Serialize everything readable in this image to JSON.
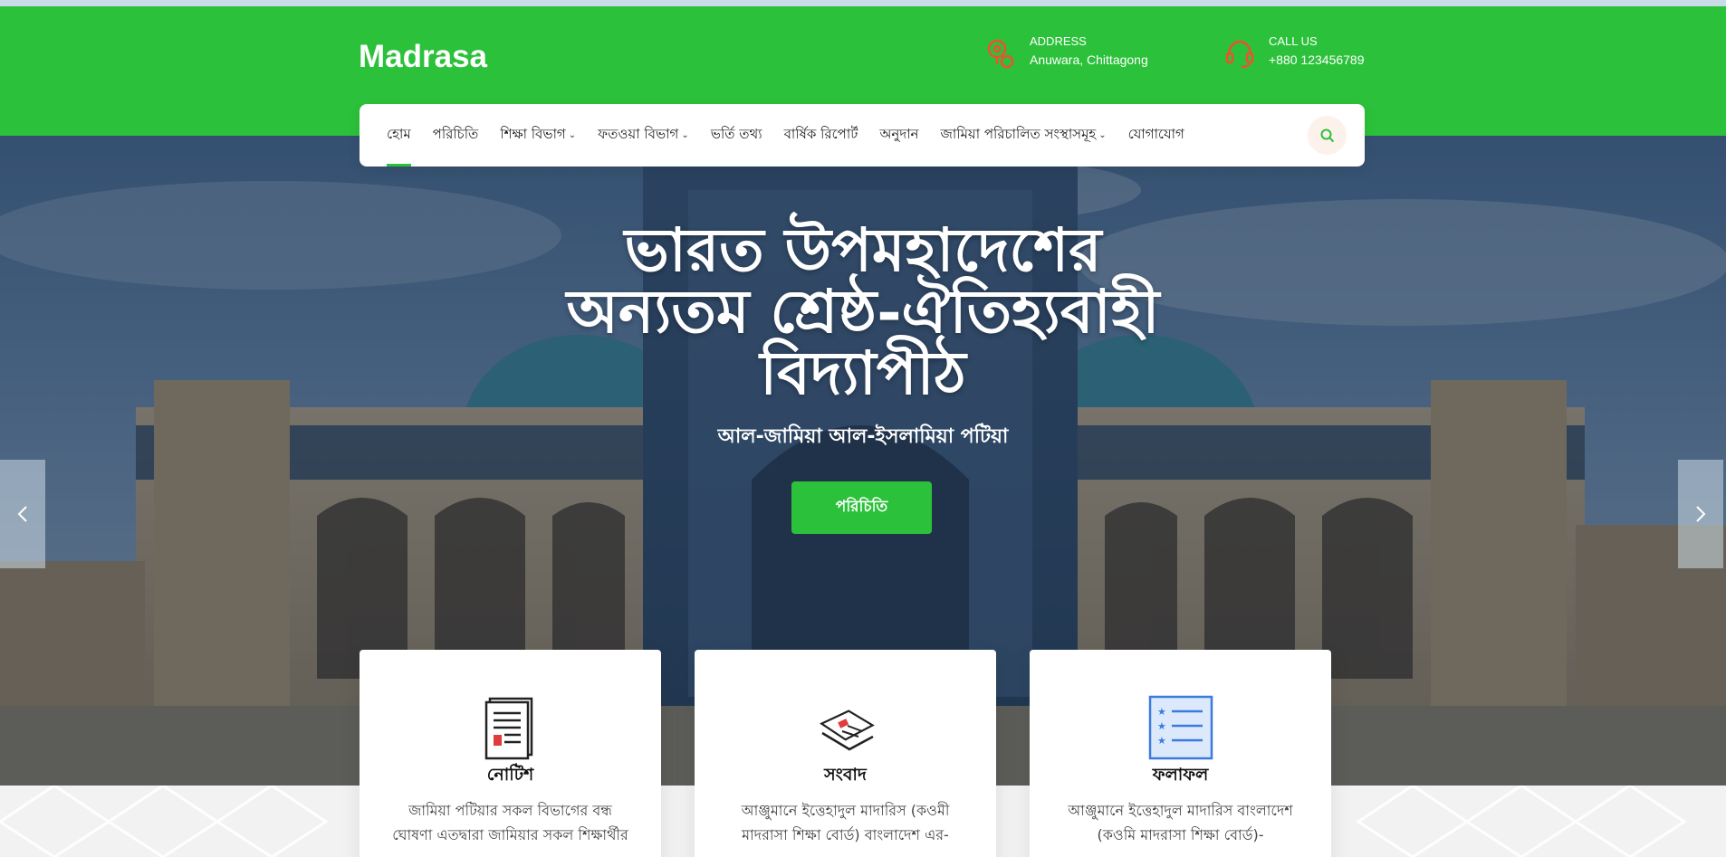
{
  "site": {
    "logo": "Madrasa"
  },
  "header": {
    "address": {
      "label": "ADDRESS",
      "value": "Anuwara, Chittagong",
      "icon": "location-pin-icon"
    },
    "call": {
      "label": "CALL US",
      "value": "+880 123456789",
      "icon": "headset-icon"
    }
  },
  "nav": {
    "items": [
      {
        "label": "হোম",
        "active": true
      },
      {
        "label": "পরিচিতি"
      },
      {
        "label": "শিক্ষা বিভাগ",
        "dropdown": true
      },
      {
        "label": "ফতওয়া বিভাগ",
        "dropdown": true
      },
      {
        "label": "ভর্তি তথ্য"
      },
      {
        "label": "বার্ষিক রিপোর্ট"
      },
      {
        "label": "অনুদান"
      },
      {
        "label": "জামিয়া পরিচালিত সংস্থাসমূহ",
        "dropdown": true
      },
      {
        "label": "যোগাযোগ"
      }
    ],
    "search_icon": "search-icon"
  },
  "hero": {
    "title_line1": "ভারত উপমহাদেশের",
    "title_line2": "অন্যতম শ্রেষ্ঠ-ঐতিহ্যবাহী",
    "title_line3": "বিদ্যাপীঠ",
    "subtitle": "আল-জামিয়া আল-ইসলামিয়া পটিয়া",
    "button": "পরিচিতি",
    "prev_icon": "chevron-left-icon",
    "next_icon": "chevron-right-icon"
  },
  "cards": [
    {
      "title": "নোটিশ",
      "icon": "notice-document-icon",
      "text": "জামিয়া পটিয়ার সকল বিভাগের বন্ধ ঘোষণা এতদ্বারা জামিয়ার সকল শিক্ষার্থীর"
    },
    {
      "title": "সংবাদ",
      "icon": "newspaper-icon",
      "text": "আঞ্জুমানে ইত্তেহাদুল মাদারিস (কওমী মাদরাসা শিক্ষা বোর্ড) বাংলাদেশ এর-"
    },
    {
      "title": "ফলাফল",
      "icon": "result-list-icon",
      "text": "আঞ্জুমানে ইত্তেহাদুল মাদারিস বাংলাদেশ (কওমি মাদরাসা শিক্ষা বোর্ড)-"
    }
  ],
  "colors": {
    "brand_green": "#2cc13a",
    "accent_orange": "#f0502e"
  }
}
